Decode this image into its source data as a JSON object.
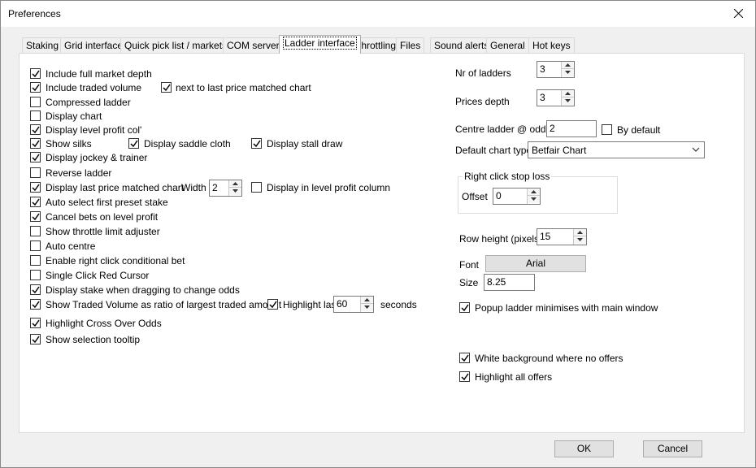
{
  "window": {
    "title": "Preferences"
  },
  "tabs": [
    "Staking",
    "Grid interface",
    "Quick pick list / markets",
    "COM server",
    "Ladder interface",
    "Throttling",
    "Files",
    "Sound alerts",
    "General",
    "Hot keys"
  ],
  "left": {
    "include_full_market_depth": "Include full market depth",
    "include_traded_volume": "Include traded volume",
    "next_to_last_price_matched_chart": "next to last price matched chart",
    "compressed_ladder": "Compressed ladder",
    "display_chart": "Display chart",
    "display_level_profit_col": "Display level profit col'",
    "show_silks": "Show silks",
    "display_saddle_cloth": "Display saddle cloth",
    "display_stall_draw": "Display stall draw",
    "display_jockey_trainer": "Display jockey & trainer",
    "reverse_ladder": "Reverse ladder",
    "display_last_price_matched_chart": "Display last price matched chart",
    "width_label": "Width",
    "width_value": "2",
    "display_in_level_profit_column": "Display in level profit column",
    "auto_select_first_preset_stake": "Auto select first preset stake",
    "cancel_bets_on_level_profit": "Cancel bets on level profit",
    "show_throttle_limit_adjuster": "Show throttle limit adjuster",
    "auto_centre": "Auto centre",
    "enable_right_click_conditional_bet": "Enable right click conditional bet",
    "single_click_red_cursor": "Single Click Red Cursor",
    "display_stake_when_dragging": "Display stake when dragging to change odds",
    "show_traded_volume_ratio": "Show Traded Volume as ratio of largest traded amount",
    "highlight_last": "Highlight last",
    "highlight_last_value": "60",
    "seconds": "seconds",
    "highlight_cross_over_odds": "Highlight Cross Over Odds",
    "show_selection_tooltip": "Show selection tooltip"
  },
  "right": {
    "nr_of_ladders_label": "Nr of ladders",
    "nr_of_ladders_value": "3",
    "prices_depth_label": "Prices depth",
    "prices_depth_value": "3",
    "centre_ladder_label": "Centre ladder @ odds",
    "centre_ladder_value": "2",
    "by_default": "By default",
    "default_chart_type_label": "Default chart type",
    "default_chart_type_value": "Betfair Chart",
    "right_click_stop_loss": "Right click stop loss",
    "offset_label": "Offset",
    "offset_value": "0",
    "row_height_label": "Row height (pixels)",
    "row_height_value": "15",
    "font_label": "Font",
    "font_value": "Arial",
    "size_label": "Size",
    "size_value": "8.25",
    "popup_ladder_minimises": "Popup ladder minimises with main window",
    "white_background": "White background where no offers",
    "highlight_all_offers": "Highlight all offers"
  },
  "buttons": {
    "ok": "OK",
    "cancel": "Cancel"
  }
}
